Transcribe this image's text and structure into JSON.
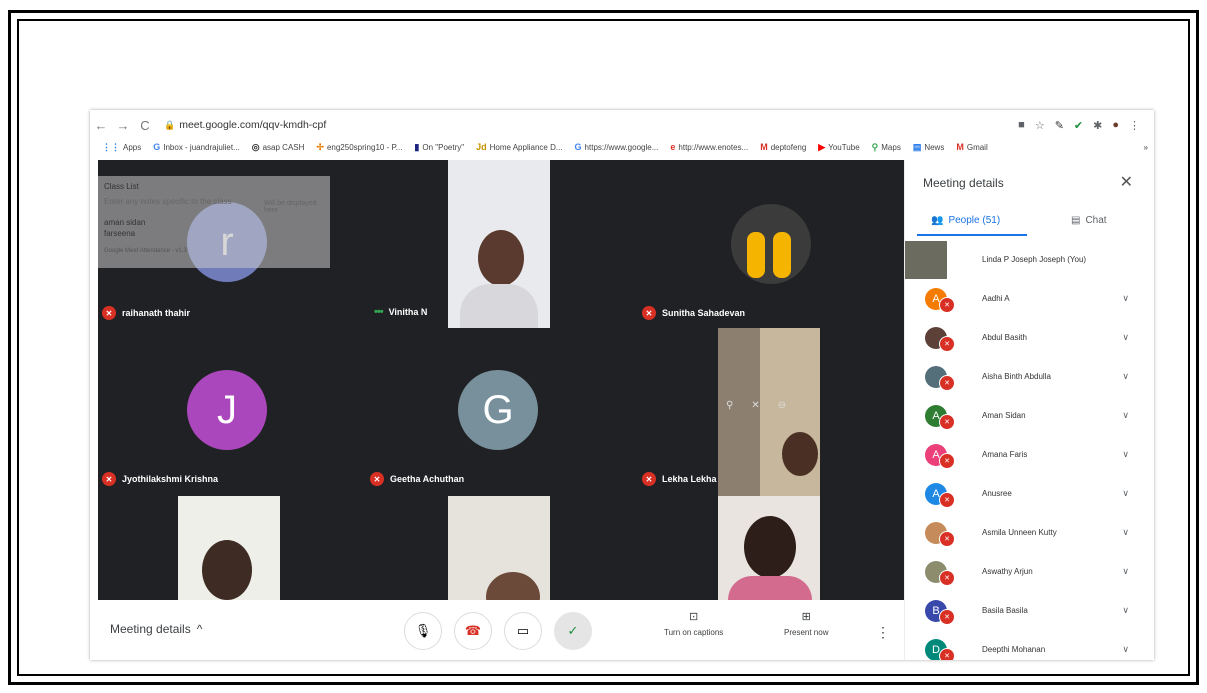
{
  "browser": {
    "url": "meet.google.com/qqv-kmdh-cpf",
    "bookmarks": [
      "Apps",
      "Inbox - juandrajuliet...",
      "asap CASH",
      "eng250spring10 - P...",
      "On \"Poetry\"",
      "Home Appliance D...",
      "https://www.google...",
      "http://www.enotes...",
      "deptofeng",
      "YouTube",
      "Maps",
      "News",
      "Gmail"
    ],
    "more_bookmarks": "»"
  },
  "overlay": {
    "title": "Class List",
    "placeholder": "Enter any notes specific to the class",
    "side_note": "Will be displayed here",
    "names": [
      "aman sidan",
      "farseena"
    ],
    "footer": "Google Meet Attendance - v1.3"
  },
  "tiles": [
    {
      "name": "raihanath thahir",
      "initial": "r",
      "color": "#7986cb",
      "muted": true
    },
    {
      "name": "Vinitha N",
      "initial": "",
      "color": "",
      "muted": false
    },
    {
      "name": "Sunitha Sahadevan",
      "initial": "",
      "color": "",
      "muted": true
    },
    {
      "name": "Jyothilakshmi Krishna",
      "initial": "J",
      "color": "#ab47bc",
      "muted": true
    },
    {
      "name": "Geetha Achuthan",
      "initial": "G",
      "color": "#78909c",
      "muted": true
    },
    {
      "name": "Lekha Lekha",
      "initial": "",
      "color": "",
      "muted": true
    }
  ],
  "bottom": {
    "meeting_details": "Meeting details",
    "captions": "Turn on captions",
    "present": "Present now"
  },
  "panel": {
    "title": "Meeting details",
    "people_tab": "People (51)",
    "chat_tab": "Chat",
    "people": [
      {
        "name": "Linda P Joseph Joseph (You)",
        "initial": "",
        "color": "#6b6b60",
        "you": true
      },
      {
        "name": "Aadhi A",
        "initial": "A",
        "color": "#f57c00"
      },
      {
        "name": "Abdul Basith",
        "initial": "",
        "color": "#5d4037"
      },
      {
        "name": "Aisha Binth Abdulla",
        "initial": "",
        "color": "#546e7a"
      },
      {
        "name": "Aman Sidan",
        "initial": "A",
        "color": "#2e7d32"
      },
      {
        "name": "Amana Faris",
        "initial": "A",
        "color": "#ec407a"
      },
      {
        "name": "Anusree",
        "initial": "A",
        "color": "#1e88e5"
      },
      {
        "name": "Asmila Unneen Kutty",
        "initial": "",
        "color": "#c58b5a"
      },
      {
        "name": "Aswathy Arjun",
        "initial": "",
        "color": "#8d8d6e"
      },
      {
        "name": "Basila Basila",
        "initial": "B",
        "color": "#3949ab"
      },
      {
        "name": "Deepthi Mohanan",
        "initial": "D",
        "color": "#00897b"
      }
    ]
  }
}
